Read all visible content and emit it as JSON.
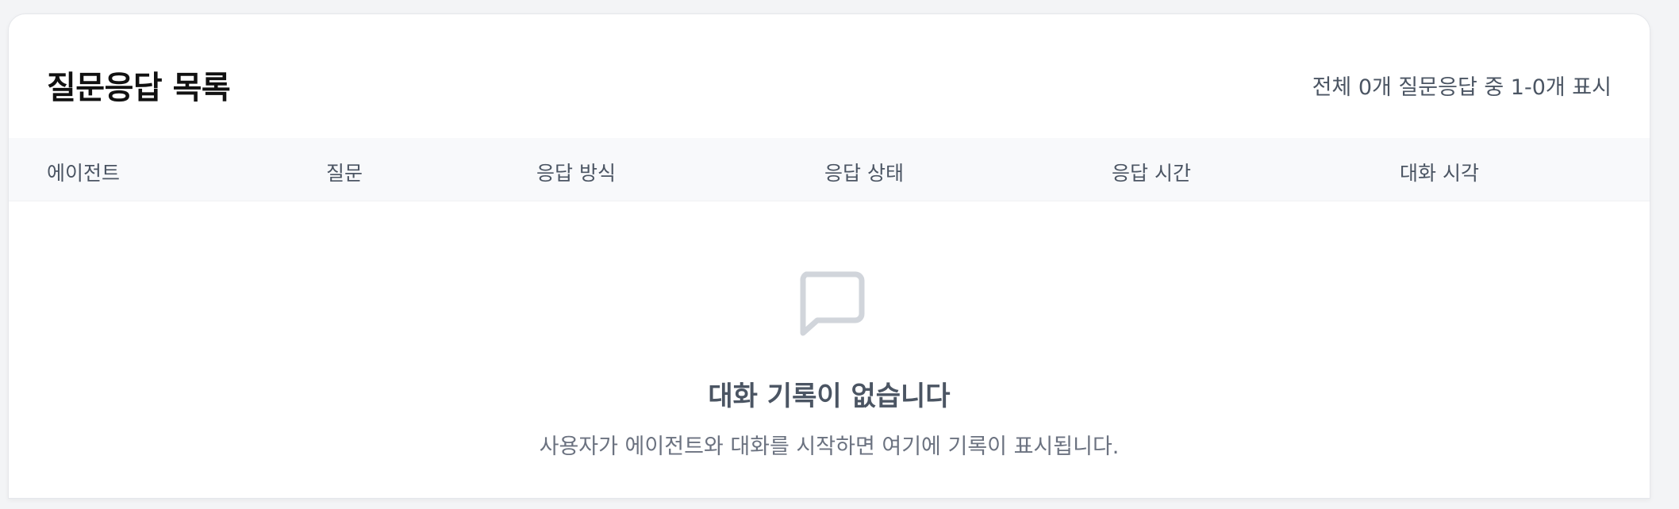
{
  "header": {
    "title": "질문응답 목록",
    "count_text": "전체 0개 질문응답 중 1-0개 표시"
  },
  "table": {
    "columns": [
      "에이전트",
      "질문",
      "응답 방식",
      "응답 상태",
      "응답 시간",
      "대화 시각"
    ],
    "rows": []
  },
  "empty_state": {
    "icon": "chat-bubble-icon",
    "title": "대화 기록이 없습니다",
    "description": "사용자가 에이전트와 대화를 시작하면 여기에 기록이 표시됩니다."
  },
  "colors": {
    "icon": "#d1d5db",
    "header_bg": "#f8f9fb"
  }
}
